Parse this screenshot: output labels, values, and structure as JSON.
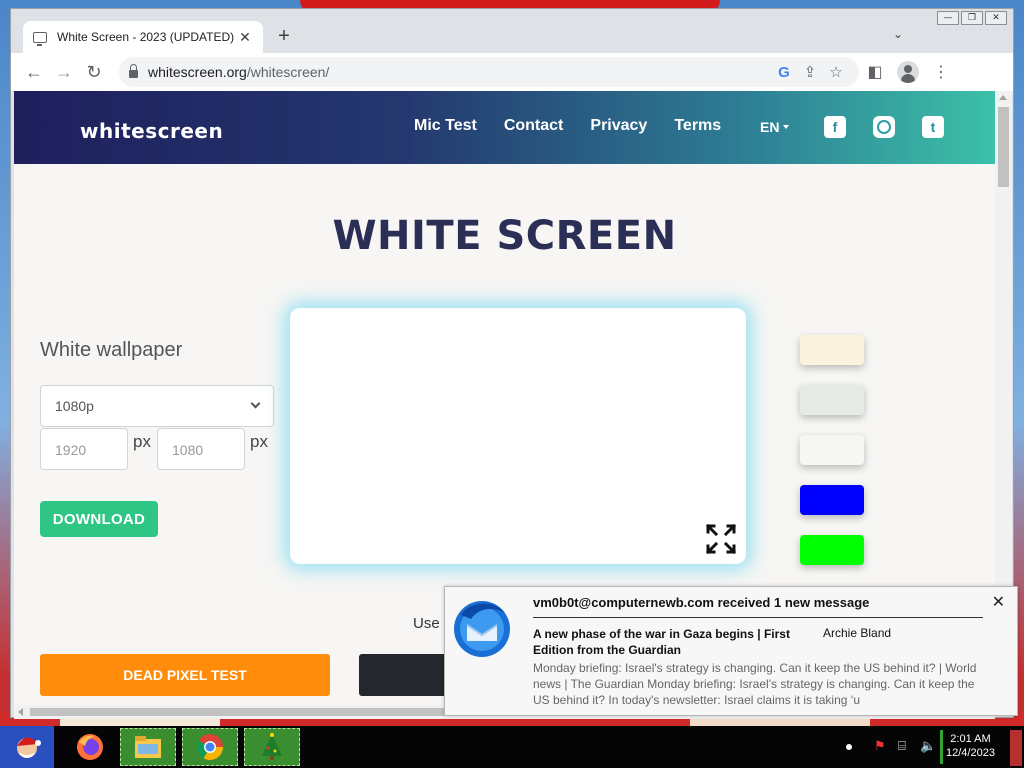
{
  "window": {
    "tab_title": "White Screen - 2023 (UPDATED)",
    "tab_close": "✕",
    "new_tab": "+",
    "tab_menu": "⌄",
    "controls": [
      "—",
      "❐",
      "✕"
    ]
  },
  "toolbar": {
    "back": "←",
    "forward": "→",
    "reload": "↻",
    "url_host": "whitescreen.org",
    "url_path": "/whitescreen/",
    "google_icon": "G",
    "share_icon": "⇪",
    "star_icon": "☆",
    "sidepanel_icon": "◧",
    "menu_icon": "⋮"
  },
  "site": {
    "logo": "whitescreen",
    "nav": [
      "Mic Test",
      "Contact",
      "Privacy",
      "Terms"
    ],
    "lang": "EN",
    "social": {
      "facebook": "f",
      "twitter": "t"
    },
    "title": "WHITE SCREEN",
    "left_title": "White wallpaper",
    "resolution": "1080p",
    "width_placeholder": "1920",
    "height_placeholder": "1080",
    "px": "px",
    "download": "DOWNLOAD",
    "use_text": "Use",
    "dead_pixel": "DEAD PIXEL TEST"
  },
  "colors": {
    "swatches": [
      "#fbf2dd",
      "#e6ebe6",
      "#f6f6f2",
      "#0000ff",
      "#00ff00"
    ],
    "header_start": "#1e1f5c",
    "header_end": "#3cc0a8",
    "download_green": "#2ec585",
    "dead_pixel_orange": "#ff8c0a"
  },
  "notification": {
    "title": "vm0b0t@computernewb.com received 1 new message",
    "close": "✕",
    "subject": "A new phase of the war in Gaza begins | First Edition from the Guardian",
    "from": "Archie Bland",
    "body": "Monday briefing: Israel's strategy is changing. Can it keep the US behind it? | World news | The Guardian Monday briefing: Israel's strategy is changing. Can it keep the US behind it? In today's newsletter: Israel claims it is taking ‘u"
  },
  "taskbar": {
    "time": "2:01 AM",
    "date": "12/4/2023",
    "apps": [
      "firefox-icon",
      "file-explorer-icon",
      "chrome-icon",
      "christmas-tree-icon"
    ]
  }
}
